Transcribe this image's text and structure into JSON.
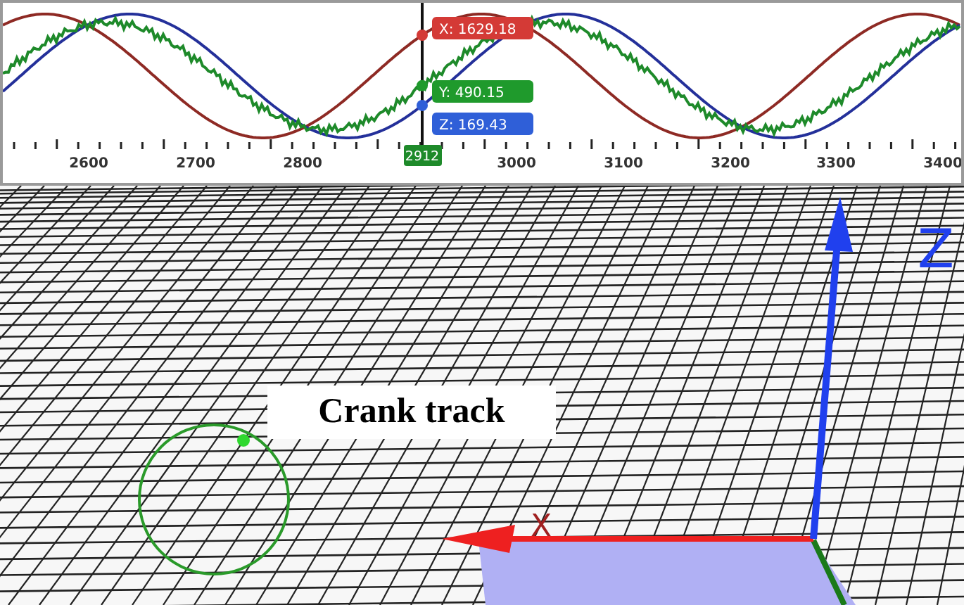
{
  "chart": {
    "ticks": [
      "2600",
      "2700",
      "2800",
      "3000",
      "3100",
      "3200",
      "3300",
      "3400"
    ],
    "cursor": {
      "label": "2912"
    },
    "readouts": [
      {
        "label": "X: 1629.18",
        "color": "#d43a36"
      },
      {
        "label": "Y: 490.15",
        "color": "#1f9a2c"
      },
      {
        "label": "Z: 169.43",
        "color": "#2f5fd8"
      }
    ]
  },
  "scene": {
    "label": "Crank track",
    "axes": [
      {
        "label": "X"
      },
      {
        "label": "Z"
      }
    ]
  }
}
